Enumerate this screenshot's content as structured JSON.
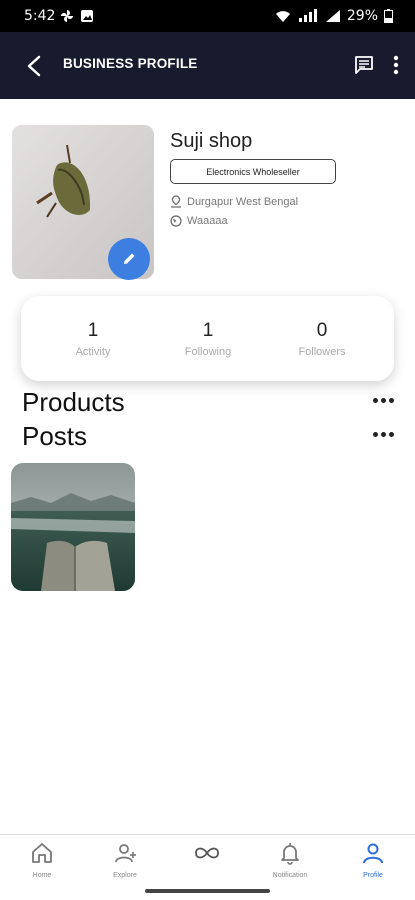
{
  "status_bar": {
    "time": "5:42",
    "battery": "29%"
  },
  "app_bar": {
    "title": "BUSINESS PROFILE"
  },
  "profile": {
    "name": "Suji shop",
    "category": "Electronics Wholeseller",
    "location": "Durgapur West Bengal",
    "website": "Waaaaa"
  },
  "stats": [
    {
      "value": "1",
      "label": "Activity"
    },
    {
      "value": "1",
      "label": "Following"
    },
    {
      "value": "0",
      "label": "Followers"
    }
  ],
  "sections": {
    "products": "Products",
    "posts": "Posts"
  },
  "bottom_nav": [
    {
      "label": "Home",
      "icon": "home-icon"
    },
    {
      "label": "Explore",
      "icon": "add-person-icon"
    },
    {
      "label": "",
      "icon": "infinity-icon"
    },
    {
      "label": "Notification",
      "icon": "bell-icon"
    },
    {
      "label": "Profile",
      "icon": "person-icon",
      "active": true
    }
  ],
  "colors": {
    "app_bar_bg": "#181a2e",
    "accent": "#3d7fe0",
    "active_nav": "#2f6fd8"
  }
}
